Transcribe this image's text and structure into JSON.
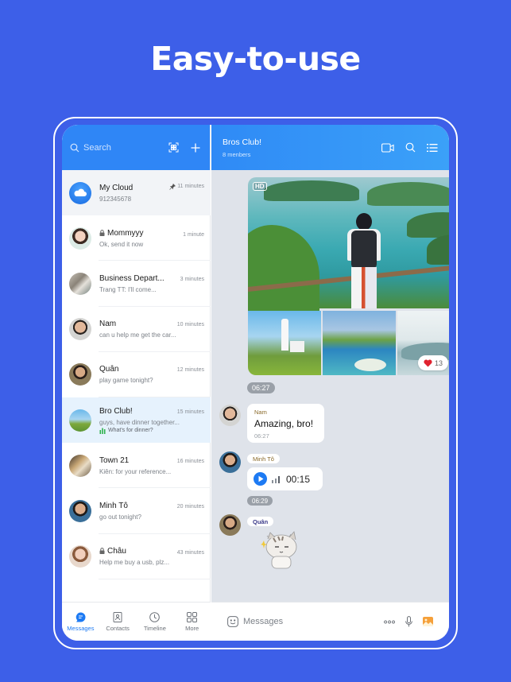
{
  "headline": "Easy-to-use",
  "sidebar": {
    "search_placeholder": "Search",
    "conversations": [
      {
        "name": "My Cloud",
        "preview": "912345678",
        "time": "11 minutes",
        "pinned": true,
        "locked": false
      },
      {
        "name": "Mommyyy",
        "preview": "Ok, send it now",
        "time": "1 minute",
        "pinned": false,
        "locked": true
      },
      {
        "name": "Business Depart...",
        "preview": "Trang TT: I'll come...",
        "time": "3 minutes",
        "pinned": false,
        "locked": false
      },
      {
        "name": "Nam",
        "preview": "can u help me get the car...",
        "time": "10 minutes",
        "pinned": false,
        "locked": false
      },
      {
        "name": "Quân",
        "preview": "play game tonight?",
        "time": "12 minutes",
        "pinned": false,
        "locked": false
      },
      {
        "name": "Bro Club!",
        "preview": "guys, have dinner together...",
        "poll": "What's for dinner?",
        "time": "15 minutes",
        "pinned": false,
        "locked": false,
        "active": true
      },
      {
        "name": "Town 21",
        "preview": "Kiên: for your reference...",
        "time": "16 minutes",
        "pinned": false,
        "locked": false
      },
      {
        "name": "Minh Tô",
        "preview": "go out tonight?",
        "time": "20 minutes",
        "pinned": false,
        "locked": false
      },
      {
        "name": "Châu",
        "preview": "Help me buy a usb, plz...",
        "time": "43 minutes",
        "pinned": false,
        "locked": true
      }
    ],
    "nav": [
      {
        "label": "Messages",
        "active": true
      },
      {
        "label": "Contacts"
      },
      {
        "label": "Timeline"
      },
      {
        "label": "More"
      }
    ]
  },
  "chat": {
    "title": "Bros Club!",
    "subtitle": "8 menbers",
    "album": {
      "badge": "HD",
      "reaction_count": "13",
      "time": "06:27"
    },
    "messages": [
      {
        "sender": "Nam",
        "text": "Amazing, bro!",
        "time": "06:27"
      },
      {
        "sender": "Minh Tô",
        "voice_duration": "00:15",
        "time": "06:29"
      },
      {
        "sender": "Quân",
        "sticker": "cat-sticker"
      }
    ],
    "composer_placeholder": "Messages"
  },
  "colors": {
    "background": "#3d5fe8",
    "header_blue": "#2f86f6",
    "active_nav": "#1d7af3",
    "heart": "#e0222f",
    "gallery_orange": "#f5a03a"
  }
}
